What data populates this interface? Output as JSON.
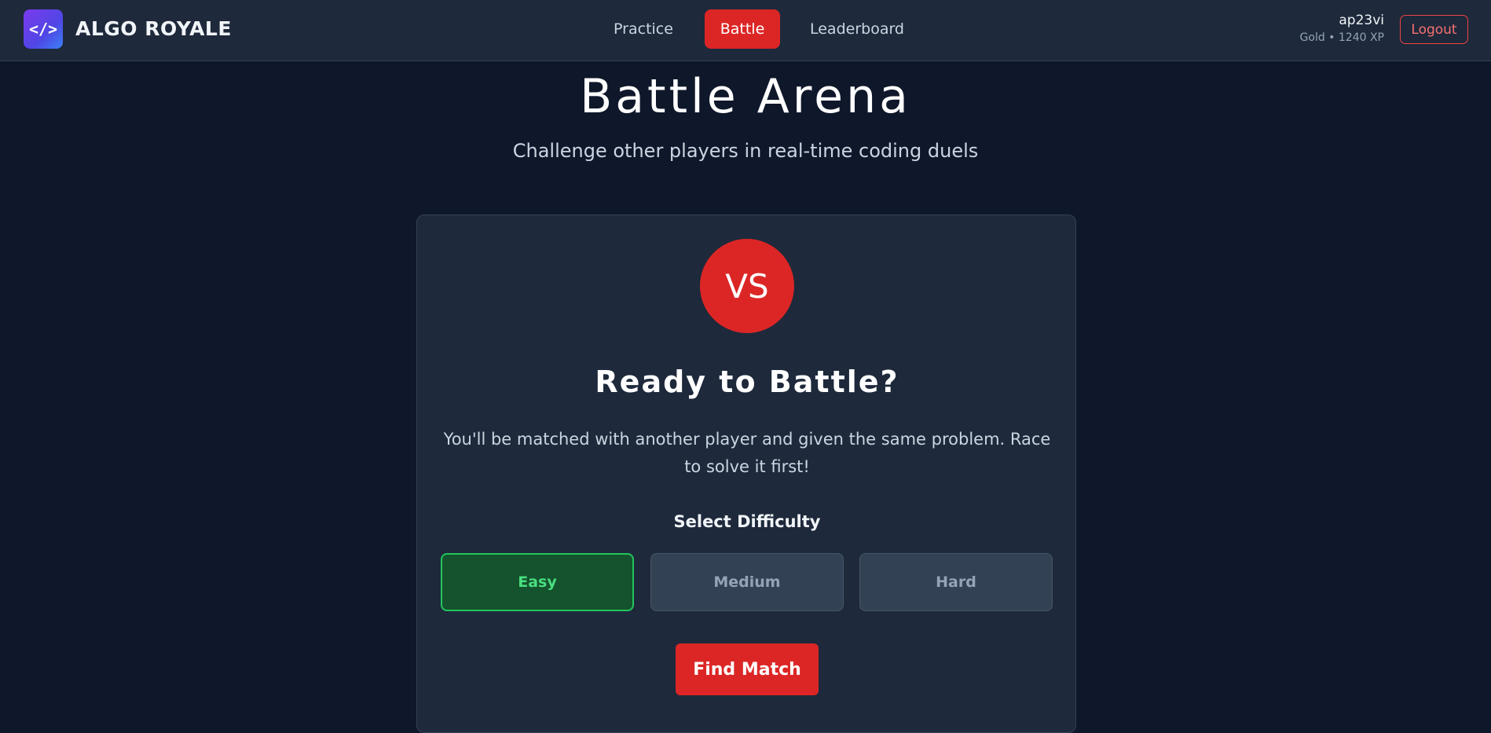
{
  "header": {
    "logo_icon": "code-icon",
    "logo_glyph": "</>",
    "brand": "ALGO ROYALE",
    "nav": [
      {
        "label": "Practice",
        "active": false
      },
      {
        "label": "Battle",
        "active": true
      },
      {
        "label": "Leaderboard",
        "active": false
      }
    ],
    "user": {
      "name": "ap23vi",
      "meta": "Gold • 1240 XP"
    },
    "logout_label": "Logout"
  },
  "main": {
    "title": "Battle Arena",
    "subtitle": "Challenge other players in real-time coding duels"
  },
  "card": {
    "vs_label": "VS",
    "heading": "Ready to Battle?",
    "description": "You'll be matched with another player and given the same problem. Race to solve it first!",
    "difficulty_label": "Select Difficulty",
    "difficulties": [
      {
        "label": "Easy",
        "selected": true
      },
      {
        "label": "Medium",
        "selected": false
      },
      {
        "label": "Hard",
        "selected": false
      }
    ],
    "find_match_label": "Find Match"
  },
  "colors": {
    "background": "#0f172a",
    "surface": "#1e293b",
    "accent_red": "#dc2626",
    "easy_green": "#22c55e"
  }
}
